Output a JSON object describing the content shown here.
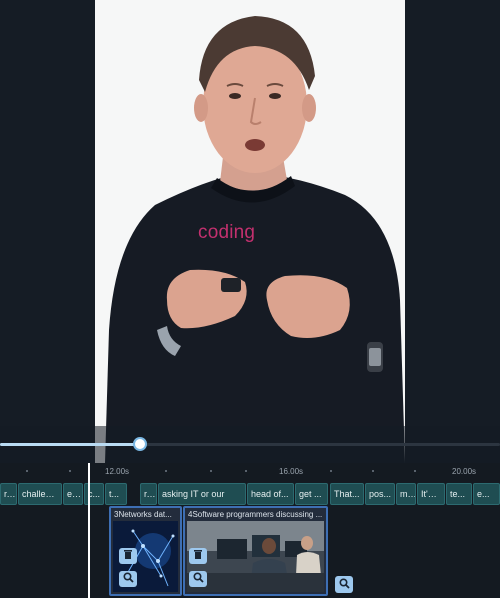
{
  "video": {
    "caption": "coding"
  },
  "scrubber": {
    "progress": 0.28
  },
  "ruler": {
    "labels": [
      "12.00s",
      "16.00s",
      "20.00s"
    ]
  },
  "word_clips": [
    "r...",
    "challen...",
    "e...",
    "c...",
    "t...",
    "r...",
    "asking IT or our",
    "head of...",
    "get ...",
    "That...",
    "pos...",
    "m...",
    "It's ...",
    "te...",
    "e..."
  ],
  "media_clips": [
    {
      "title": "3Networks dat..."
    },
    {
      "title": "4Software programmers discussing ..."
    }
  ],
  "icons": {
    "delete": "trash-icon",
    "zoom": "magnifier-icon"
  },
  "colors": {
    "caption": "#c2306e",
    "word_clip": "#1f4d52",
    "media_clip_border": "#3e6fb4",
    "clip_button": "#9dc8ee"
  }
}
